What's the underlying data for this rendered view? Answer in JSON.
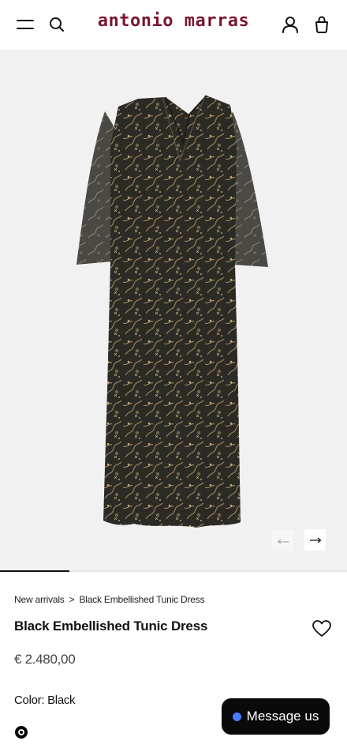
{
  "header": {
    "brand": "antonio marras",
    "brand_color": "#7a1530",
    "icons": [
      "menu-icon",
      "search-icon",
      "account-icon",
      "bag-icon"
    ]
  },
  "gallery": {
    "image_alt": "Black Embellished Tunic Dress",
    "progress": 0.2
  },
  "breadcrumb": {
    "items": [
      "New arrivals",
      "Black Embellished Tunic Dress"
    ],
    "separator": ">"
  },
  "product": {
    "title": "Black Embellished Tunic Dress",
    "price": "€ 2.480,00",
    "color_label": "Color: Black",
    "swatch_color": "#000000"
  },
  "chat": {
    "label": "Message us",
    "dot_color": "#4b7cff"
  }
}
